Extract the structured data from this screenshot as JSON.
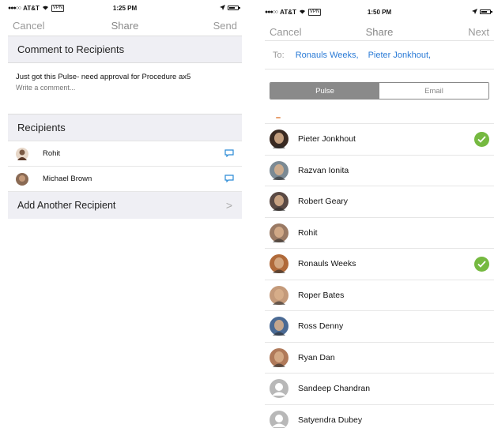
{
  "left": {
    "status": {
      "signal": "●●●○○",
      "carrier": "AT&T",
      "vpn": "VPN",
      "time": "1:25 PM"
    },
    "nav": {
      "cancel": "Cancel",
      "title": "Share",
      "send": "Send"
    },
    "comment_header": "Comment to Recipients",
    "comment_text": "Just got this Pulse- need approval for Procedure ax5",
    "comment_placeholder": "Write a comment...",
    "recipients_header": "Recipients",
    "recipients": [
      {
        "name": "Rohit",
        "icon": "chat-icon"
      },
      {
        "name": "Michael Brown",
        "icon": "chat-icon"
      }
    ],
    "add_recipient": "Add Another Recipient",
    "add_chevron": ">"
  },
  "right": {
    "status": {
      "signal": "●●●○○",
      "carrier": "AT&T",
      "vpn": "VPN",
      "time": "1:50 PM"
    },
    "nav": {
      "cancel": "Cancel",
      "title": "Share",
      "next": "Next"
    },
    "to_label": "To:",
    "to_names": [
      "Ronauls Weeks,",
      "Pieter Jonkhout,"
    ],
    "tabs": [
      {
        "label": "Pulse",
        "active": true
      },
      {
        "label": "Email",
        "active": false
      }
    ],
    "contacts": [
      {
        "name": "Pieter Jonkhout",
        "checked": true,
        "avatar_color": "#3a2a22"
      },
      {
        "name": "Razvan Ionita",
        "checked": false,
        "avatar_color": "#7b8a94"
      },
      {
        "name": "Robert Geary",
        "checked": false,
        "avatar_color": "#5a4a44"
      },
      {
        "name": "Rohit",
        "checked": false,
        "avatar_color": "#9a7a64"
      },
      {
        "name": "Ronauls Weeks",
        "checked": true,
        "avatar_color": "#b06a3a"
      },
      {
        "name": "Roper Bates",
        "checked": false,
        "avatar_color": "#c49a7a"
      },
      {
        "name": "Ross Denny",
        "checked": false,
        "avatar_color": "#4a6a94"
      },
      {
        "name": "Ryan Dan",
        "checked": false,
        "avatar_color": "#b07a5a"
      },
      {
        "name": "Sandeep Chandran",
        "checked": false,
        "avatar_color": "#b8b8b8"
      },
      {
        "name": "Satyendra Dubey",
        "checked": false,
        "avatar_color": "#b8b8b8"
      }
    ],
    "check_color": "#75b940",
    "link_color": "#2b7bd6"
  }
}
